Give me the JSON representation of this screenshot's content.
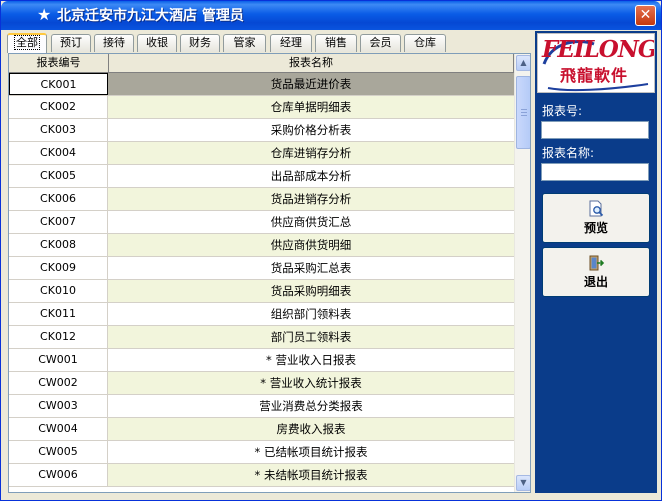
{
  "window": {
    "title_star": "★",
    "title": "北京迁安市九江大酒店 管理员",
    "close": "✕"
  },
  "tabs": [
    {
      "label": "全部",
      "active": true
    },
    {
      "label": "预订"
    },
    {
      "label": "接待"
    },
    {
      "label": "收银"
    },
    {
      "label": "财务"
    },
    {
      "label": "管家"
    },
    {
      "label": "经理"
    },
    {
      "label": "销售"
    },
    {
      "label": "会员"
    },
    {
      "label": "仓库"
    }
  ],
  "table": {
    "columns": [
      "报表编号",
      "报表名称"
    ],
    "rows": [
      {
        "id": "CK001",
        "name": "货品最近进价表",
        "selected": true
      },
      {
        "id": "CK002",
        "name": "仓库单据明细表"
      },
      {
        "id": "CK003",
        "name": "采购价格分析表"
      },
      {
        "id": "CK004",
        "name": "仓库进销存分析"
      },
      {
        "id": "CK005",
        "name": "出品部成本分析"
      },
      {
        "id": "CK006",
        "name": "货品进销存分析"
      },
      {
        "id": "CK007",
        "name": "供应商供货汇总"
      },
      {
        "id": "CK008",
        "name": "供应商供货明细"
      },
      {
        "id": "CK009",
        "name": "货品采购汇总表"
      },
      {
        "id": "CK010",
        "name": "货品采购明细表"
      },
      {
        "id": "CK011",
        "name": "组织部门领料表"
      },
      {
        "id": "CK012",
        "name": "部门员工领料表"
      },
      {
        "id": "CW001",
        "name": "* 营业收入日报表"
      },
      {
        "id": "CW002",
        "name": "* 营业收入统计报表"
      },
      {
        "id": "CW003",
        "name": "营业消费总分类报表"
      },
      {
        "id": "CW004",
        "name": "房费收入报表"
      },
      {
        "id": "CW005",
        "name": "* 已结帐项目统计报表"
      },
      {
        "id": "CW006",
        "name": "* 未结帐项目统计报表"
      }
    ]
  },
  "sidebar": {
    "logo_text": "FEILONG",
    "logo_subtext": "飛龍軟件",
    "report_no_label": "报表号:",
    "report_no_value": "",
    "report_name_label": "报表名称:",
    "report_name_value": "",
    "preview_label": "预览",
    "exit_label": "退出"
  },
  "icons": {
    "preview": "magnifier-document-icon",
    "exit": "exit-door-icon",
    "scroll_up": "▲",
    "scroll_down": "▼"
  },
  "colors": {
    "sidebar_bg": "#0a3c8a",
    "selected_row": "#a9a79b",
    "alt_row": "#f2f5dc",
    "logo_red": "#c8102e"
  }
}
